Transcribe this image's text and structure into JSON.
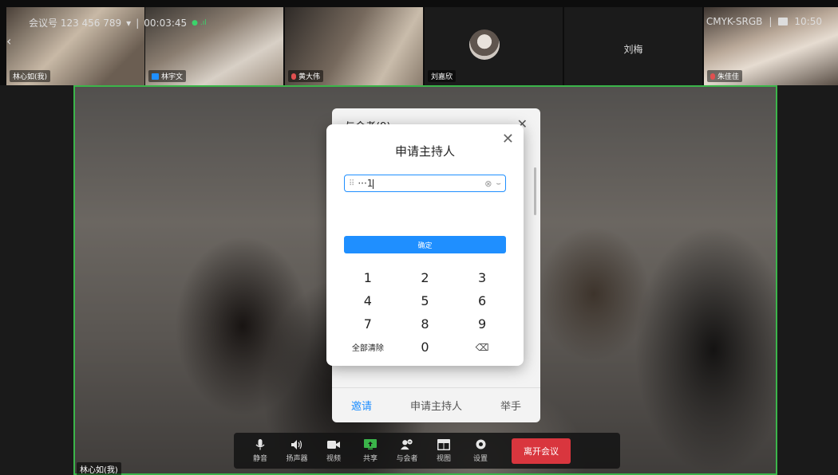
{
  "meeting": {
    "id_label": "会议号 123 456 789",
    "dropdown_glyph": "▾",
    "separator": "|",
    "duration": "00:03:45",
    "signal": "● .ıl"
  },
  "top_right": {
    "color_profile": "CMYK-SRGB",
    "separator": "|",
    "clock": "10:50"
  },
  "participants_strip": [
    {
      "name": "林心如(我)",
      "active": true
    },
    {
      "name": "林宇文",
      "badge": "share"
    },
    {
      "name": "黄大伟",
      "badge": "mic-off"
    },
    {
      "name": "刘嘉欣"
    },
    {
      "name": "刘梅"
    },
    {
      "name": "朱佳佳",
      "badge": "mic-off"
    }
  ],
  "main_speaker_name": "林心如(我)",
  "panel": {
    "title": "与会者(9)",
    "close_glyph": "✕",
    "actions": {
      "invite": "邀请",
      "request_host": "申请主持人",
      "raise_hand": "举手"
    }
  },
  "dialog": {
    "title": "申请主持人",
    "close_glyph": "✕",
    "password": {
      "value": "···1",
      "lock_glyph": "⠿",
      "clear_glyph": "⊗",
      "eye_glyph": "⌣"
    },
    "confirm_label": "确定",
    "keypad": [
      [
        "1",
        "2",
        "3"
      ],
      [
        "4",
        "5",
        "6"
      ],
      [
        "7",
        "8",
        "9"
      ],
      [
        "全部清除",
        "0",
        "⌫"
      ]
    ]
  },
  "toolbar": {
    "mute": "静音",
    "speaker": "扬声器",
    "video": "视频",
    "share": "共享",
    "participants": "与会者",
    "view": "视图",
    "settings": "设置",
    "leave": "离开会议"
  },
  "colors": {
    "accent": "#1f8fff",
    "leave": "#d9363e",
    "active_border": "#3bb54a"
  }
}
